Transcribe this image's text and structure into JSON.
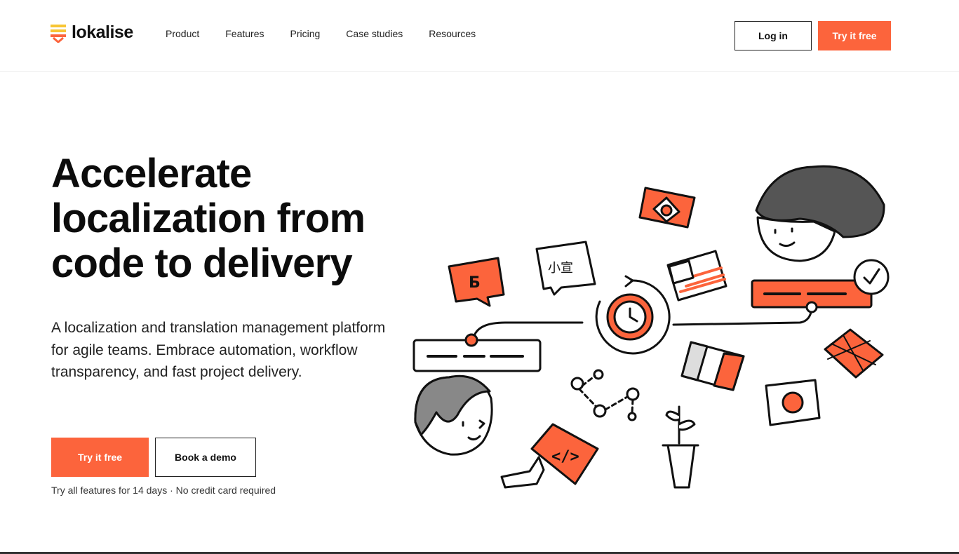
{
  "brand": {
    "name": "lokalise",
    "accent": "#fc643c",
    "logo_yellow": "#f7c534"
  },
  "nav": {
    "items": [
      {
        "label": "Product"
      },
      {
        "label": "Features"
      },
      {
        "label": "Pricing"
      },
      {
        "label": "Case studies"
      },
      {
        "label": "Resources"
      }
    ],
    "login_label": "Log in",
    "try_label": "Try it free"
  },
  "hero": {
    "title": "Accelerate localization from code to delivery",
    "subtitle": "A localization and translation management platform for agile teams. Embrace automation, workflow transparency, and fast project delivery.",
    "primary_cta": "Try it free",
    "secondary_cta": "Book a demo",
    "note": "Try all features for 14 days · No credit card required"
  },
  "illustration": {
    "bubble_cyrillic": "Б",
    "bubble_chinese": "小宣",
    "code_symbol": "</>",
    "icons": [
      "speech-bubble-icon",
      "flag-icon",
      "clock-icon",
      "person-icon",
      "plant-icon",
      "code-icon",
      "checkmark-icon"
    ]
  }
}
